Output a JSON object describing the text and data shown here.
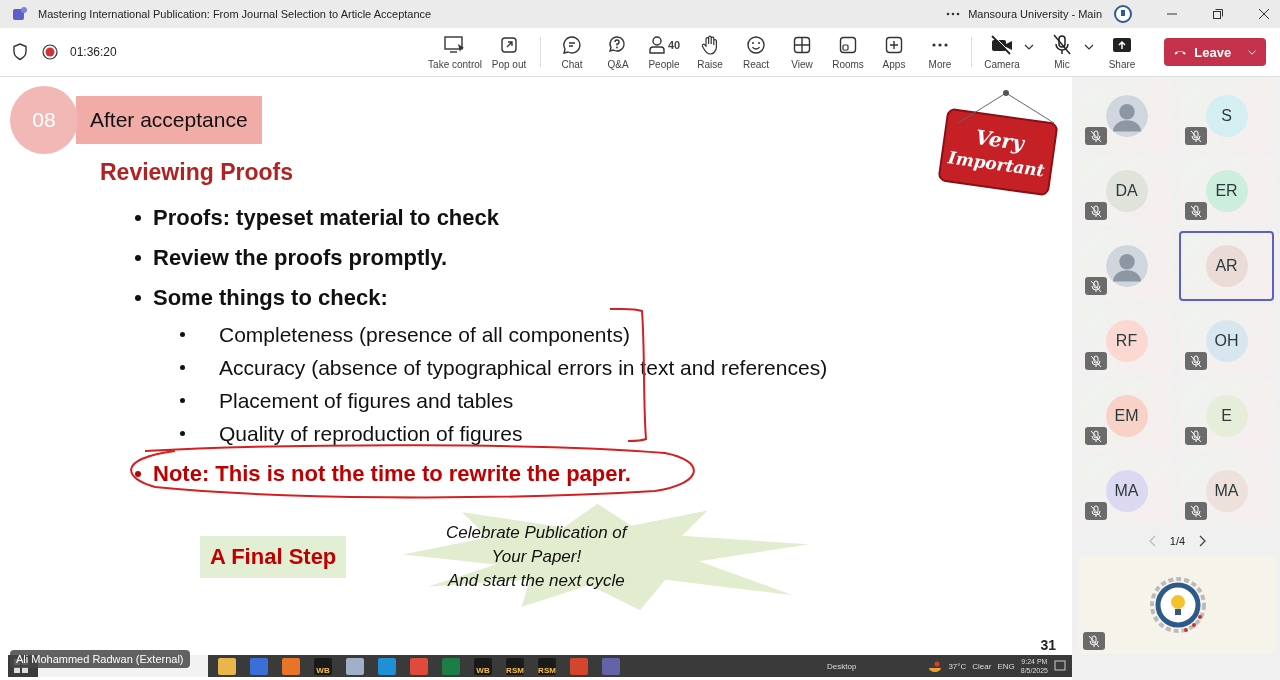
{
  "window": {
    "title": "Mastering International Publication: From Journal Selection to Article Acceptance",
    "account": "Mansoura University - Main"
  },
  "meeting": {
    "timer": "01:36:20",
    "recording": true
  },
  "toolbar": [
    {
      "kind": "take-control",
      "label": "Take control"
    },
    {
      "kind": "pop-out",
      "label": "Pop out"
    },
    {
      "kind": "divider"
    },
    {
      "kind": "chat",
      "label": "Chat"
    },
    {
      "kind": "qa",
      "label": "Q&A"
    },
    {
      "kind": "people",
      "label": "People",
      "count": "40"
    },
    {
      "kind": "raise",
      "label": "Raise"
    },
    {
      "kind": "react",
      "label": "React"
    },
    {
      "kind": "view",
      "label": "View"
    },
    {
      "kind": "rooms",
      "label": "Rooms"
    },
    {
      "kind": "apps",
      "label": "Apps"
    },
    {
      "kind": "more",
      "label": "More"
    },
    {
      "kind": "divider"
    }
  ],
  "devices": [
    {
      "kind": "camera",
      "label": "Camera",
      "off": true
    },
    {
      "kind": "mic",
      "label": "Mic",
      "off": true
    },
    {
      "kind": "share",
      "label": "Share"
    }
  ],
  "leave": {
    "label": "Leave"
  },
  "slide": {
    "number": "08",
    "section": "After acceptance",
    "heading": "Reviewing Proofs",
    "bullets": [
      {
        "text": "Proofs: typeset material to check"
      },
      {
        "text": "Review the proofs promptly."
      },
      {
        "text": "Some things to check:",
        "children": [
          "Completeness (presence of all components)",
          "Accuracy (absence of typographical errors in text and references)",
          "Placement of figures and tables",
          "Quality of reproduction of figures"
        ]
      }
    ],
    "note": "Note: This is not the time to rewrite the paper.",
    "sign": [
      "Very",
      "Important"
    ],
    "final_step": "A Final Step",
    "celebrate": [
      "Celebrate Publication of",
      "Your Paper!",
      "And start the next cycle"
    ],
    "page": "31"
  },
  "presenter": "Ali Mohammed Radwan (External)",
  "taskbar": {
    "apps": [
      {
        "color": "#e8b64a"
      },
      {
        "color": "#3a6fd8"
      },
      {
        "color": "#e8742a"
      },
      {
        "color": "#1a1a1a",
        "label": "WB"
      },
      {
        "color": "#9fb0c8"
      },
      {
        "color": "#1f8fd6"
      },
      {
        "color": "#e04a3a"
      },
      {
        "color": "#1e7d45"
      },
      {
        "color": "#1a1a1a",
        "label": "WB"
      },
      {
        "color": "#1a1a1a",
        "label": "RSM"
      },
      {
        "color": "#1a1a1a",
        "label": "RSM"
      },
      {
        "color": "#d2472c"
      },
      {
        "color": "#6264a7"
      }
    ],
    "tray": {
      "desktop": "Desktop",
      "temperature": "37°C",
      "weather": "Clear",
      "language": "ENG",
      "time": "9:24 PM",
      "date": "8/5/2025"
    }
  },
  "participants": [
    {
      "kind": "photo",
      "muted": true,
      "selected": false
    },
    {
      "kind": "initials",
      "initials": "S",
      "color": "#d4eef2",
      "muted": true,
      "selected": false
    },
    {
      "kind": "initials",
      "initials": "DA",
      "color": "#dfe3da",
      "muted": true,
      "selected": false
    },
    {
      "kind": "initials",
      "initials": "ER",
      "color": "#cdeedd",
      "muted": true,
      "selected": false
    },
    {
      "kind": "photo",
      "muted": true,
      "selected": false
    },
    {
      "kind": "initials",
      "initials": "AR",
      "color": "#eadbd6",
      "muted": false,
      "selected": true
    },
    {
      "kind": "initials",
      "initials": "RF",
      "color": "#fbd9d2",
      "muted": true,
      "selected": false
    },
    {
      "kind": "initials",
      "initials": "OH",
      "color": "#d8e7ef",
      "muted": true,
      "selected": false
    },
    {
      "kind": "initials",
      "initials": "EM",
      "color": "#f8d2c6",
      "muted": true,
      "selected": false
    },
    {
      "kind": "initials",
      "initials": "E",
      "color": "#e6eedb",
      "muted": true,
      "selected": false
    },
    {
      "kind": "initials",
      "initials": "MA",
      "color": "#ddd8f2",
      "muted": true,
      "selected": false
    },
    {
      "kind": "initials",
      "initials": "MA",
      "color": "#eee0da",
      "muted": true,
      "selected": false
    }
  ],
  "pager": "1/4",
  "content_tile": {
    "kind": "logo",
    "muted": true
  }
}
